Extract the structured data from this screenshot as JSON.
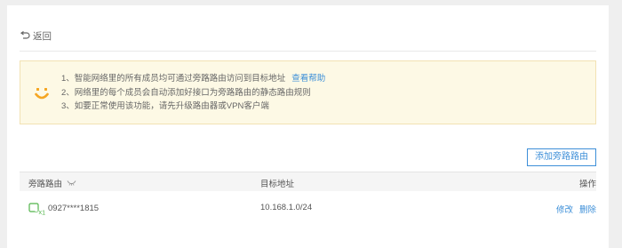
{
  "back": {
    "label": "返回"
  },
  "notice": {
    "lines": [
      "1、智能网络里的所有成员均可通过旁路路由访问到目标地址",
      "2、网络里的每个成员会自动添加好接口为旁路路由的静态路由规则",
      "3、如要正常使用该功能，请先升级路由器或VPN客户端"
    ],
    "help_link": "查看帮助",
    "icon": "smile-icon",
    "accent": "#f5a623"
  },
  "toolbar": {
    "add_label": "添加旁路路由"
  },
  "table": {
    "headers": {
      "router": "旁路路由",
      "target": "目标地址",
      "actions": "操作"
    },
    "rows": [
      {
        "router": "0927****1815",
        "device_badge": "1",
        "target": "10.168.1.0/24",
        "edit": "修改",
        "delete": "删除"
      }
    ]
  },
  "colors": {
    "link": "#3d8fd8",
    "device_green": "#52b54b"
  }
}
